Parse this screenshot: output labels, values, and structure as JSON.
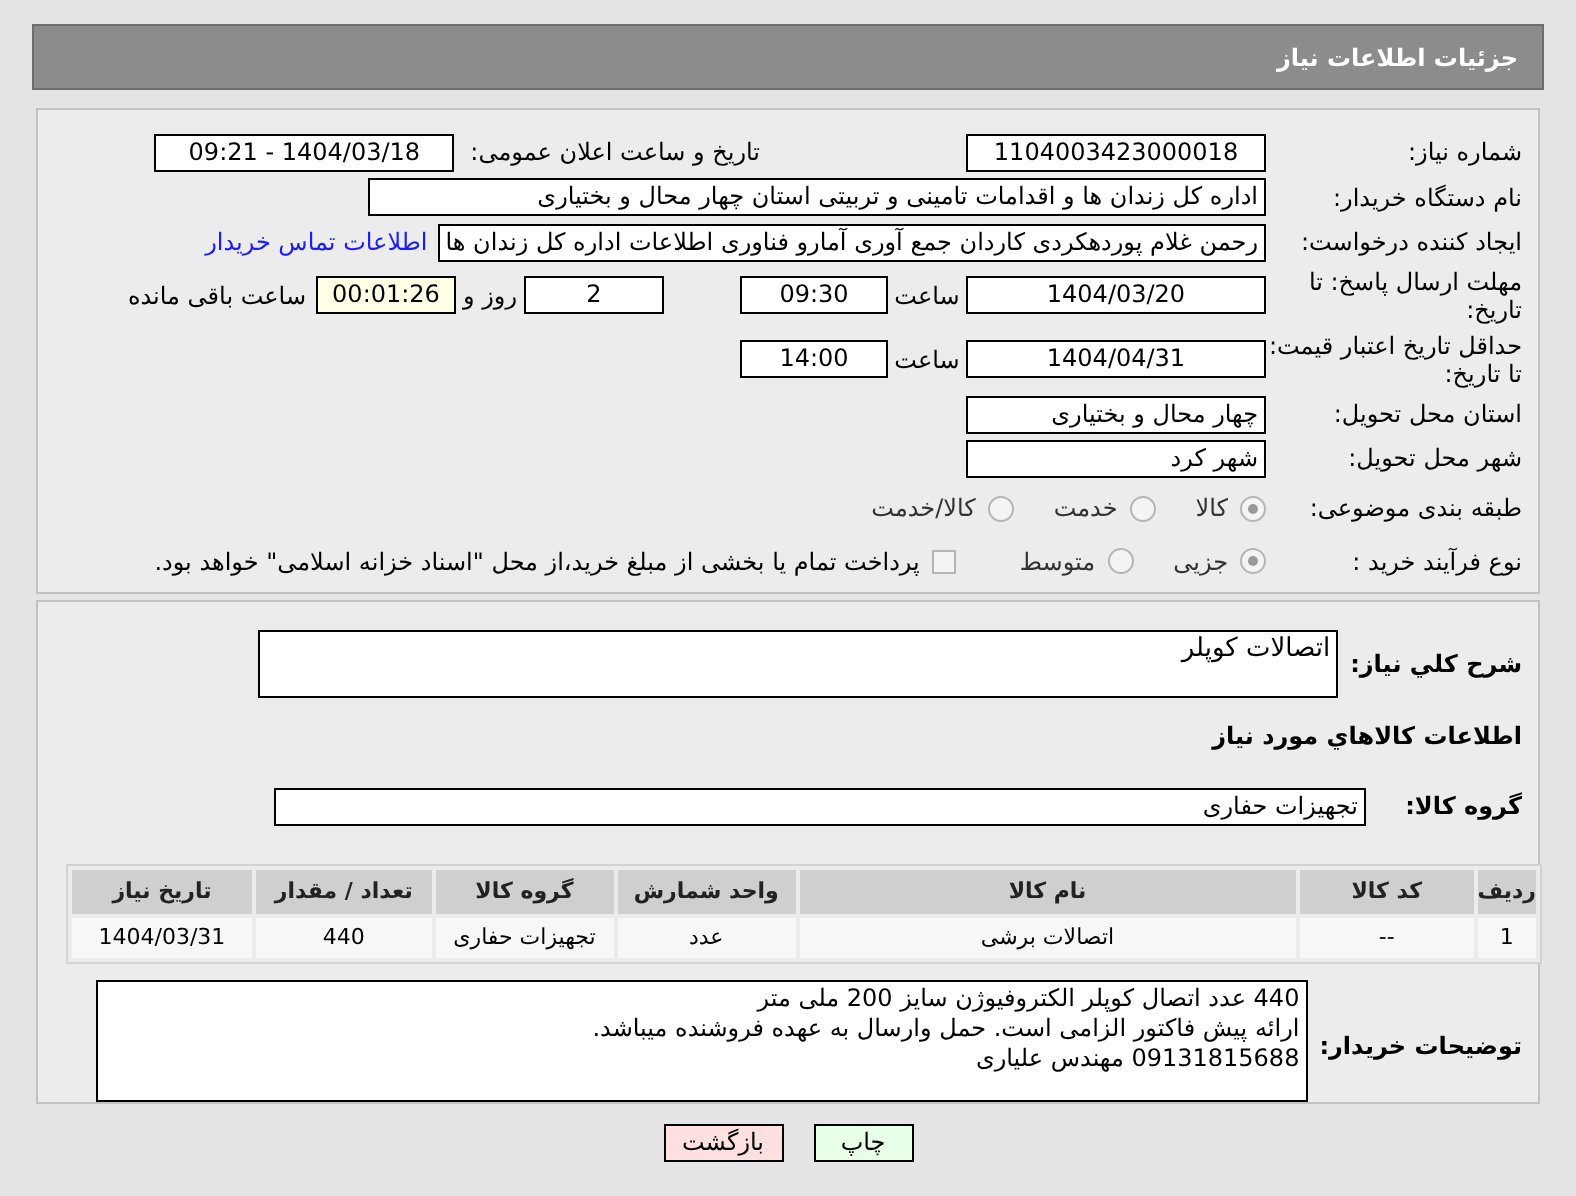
{
  "header": {
    "title": "جزئیات اطلاعات نیاز"
  },
  "details": {
    "need_number": {
      "label": "شماره نیاز:",
      "value": "1104003423000018"
    },
    "announce": {
      "label": "تاریخ و ساعت اعلان عمومی:",
      "value": "1404/03/18 - 09:21"
    },
    "buyer": {
      "label": "نام دستگاه خریدار:",
      "value": "اداره کل زندان ها و اقدامات تامینی و تربیتی استان چهار محال و بختیاری"
    },
    "requester": {
      "label": "ایجاد کننده درخواست:",
      "value": "رحمن غلام پوردهکردی کاردان جمع آوری آمارو فناوری اطلاعات اداره کل زندان ها",
      "link": "اطلاعات تماس خریدار"
    },
    "deadline": {
      "label": "مهلت ارسال پاسخ: تا تاریخ:",
      "date": "1404/03/20",
      "time_label": "ساعت",
      "time": "09:30",
      "days": "2",
      "days_label": "روز و",
      "remaining": "00:01:26",
      "remaining_label": "ساعت باقی مانده"
    },
    "validity": {
      "label": "حداقل تاریخ اعتبار قیمت: تا تاریخ:",
      "date": "1404/04/31",
      "time_label": "ساعت",
      "time": "14:00"
    },
    "province": {
      "label": "استان محل تحویل:",
      "value": "چهار محال و بختیاری"
    },
    "city": {
      "label": "شهر محل تحویل:",
      "value": "شهر کرد"
    },
    "category": {
      "label": "طبقه بندی موضوعی:",
      "options": [
        {
          "label": "کالا",
          "selected": true
        },
        {
          "label": "خدمت",
          "selected": false
        },
        {
          "label": "کالا/خدمت",
          "selected": false
        }
      ]
    },
    "process": {
      "label": "نوع فرآیند خرید :",
      "options": [
        {
          "label": "جزیی",
          "selected": true
        },
        {
          "label": "متوسط",
          "selected": false
        }
      ],
      "payment": {
        "label": "پرداخت تمام یا بخشی از مبلغ خرید،از محل \"اسناد خزانه اسلامی\" خواهد بود.",
        "checked": false
      }
    }
  },
  "need": {
    "description_label": "شرح کلي نیاز:",
    "description": "اتصالات کوپلر",
    "goods_heading": "اطلاعات کالاهاي مورد نیاز",
    "group_label": "گروه کالا:",
    "group": "تجهیزات حفاری",
    "table": {
      "columns": [
        "ردیف",
        "کد کالا",
        "نام کالا",
        "واحد شمارش",
        "گروه کالا",
        "تعداد / مقدار",
        "تاریخ نیاز"
      ],
      "rows": [
        [
          "1",
          "--",
          "اتصالات برشی",
          "عدد",
          "تجهیزات حفاری",
          "440",
          "1404/03/31"
        ]
      ]
    },
    "notes_label": "توضیحات خریدار:",
    "notes": [
      "440 عدد اتصال کوپلر الکتروفیوژن سایز 200 ملی متر",
      "ارائه پیش فاکتور الزامی است. حمل وارسال به عهده فروشنده میباشد.",
      "09131815688 مهندس علیاری"
    ]
  },
  "buttons": [
    {
      "label": "چاپ",
      "kind": "print"
    },
    {
      "label": "بازگشت",
      "kind": "back"
    }
  ]
}
